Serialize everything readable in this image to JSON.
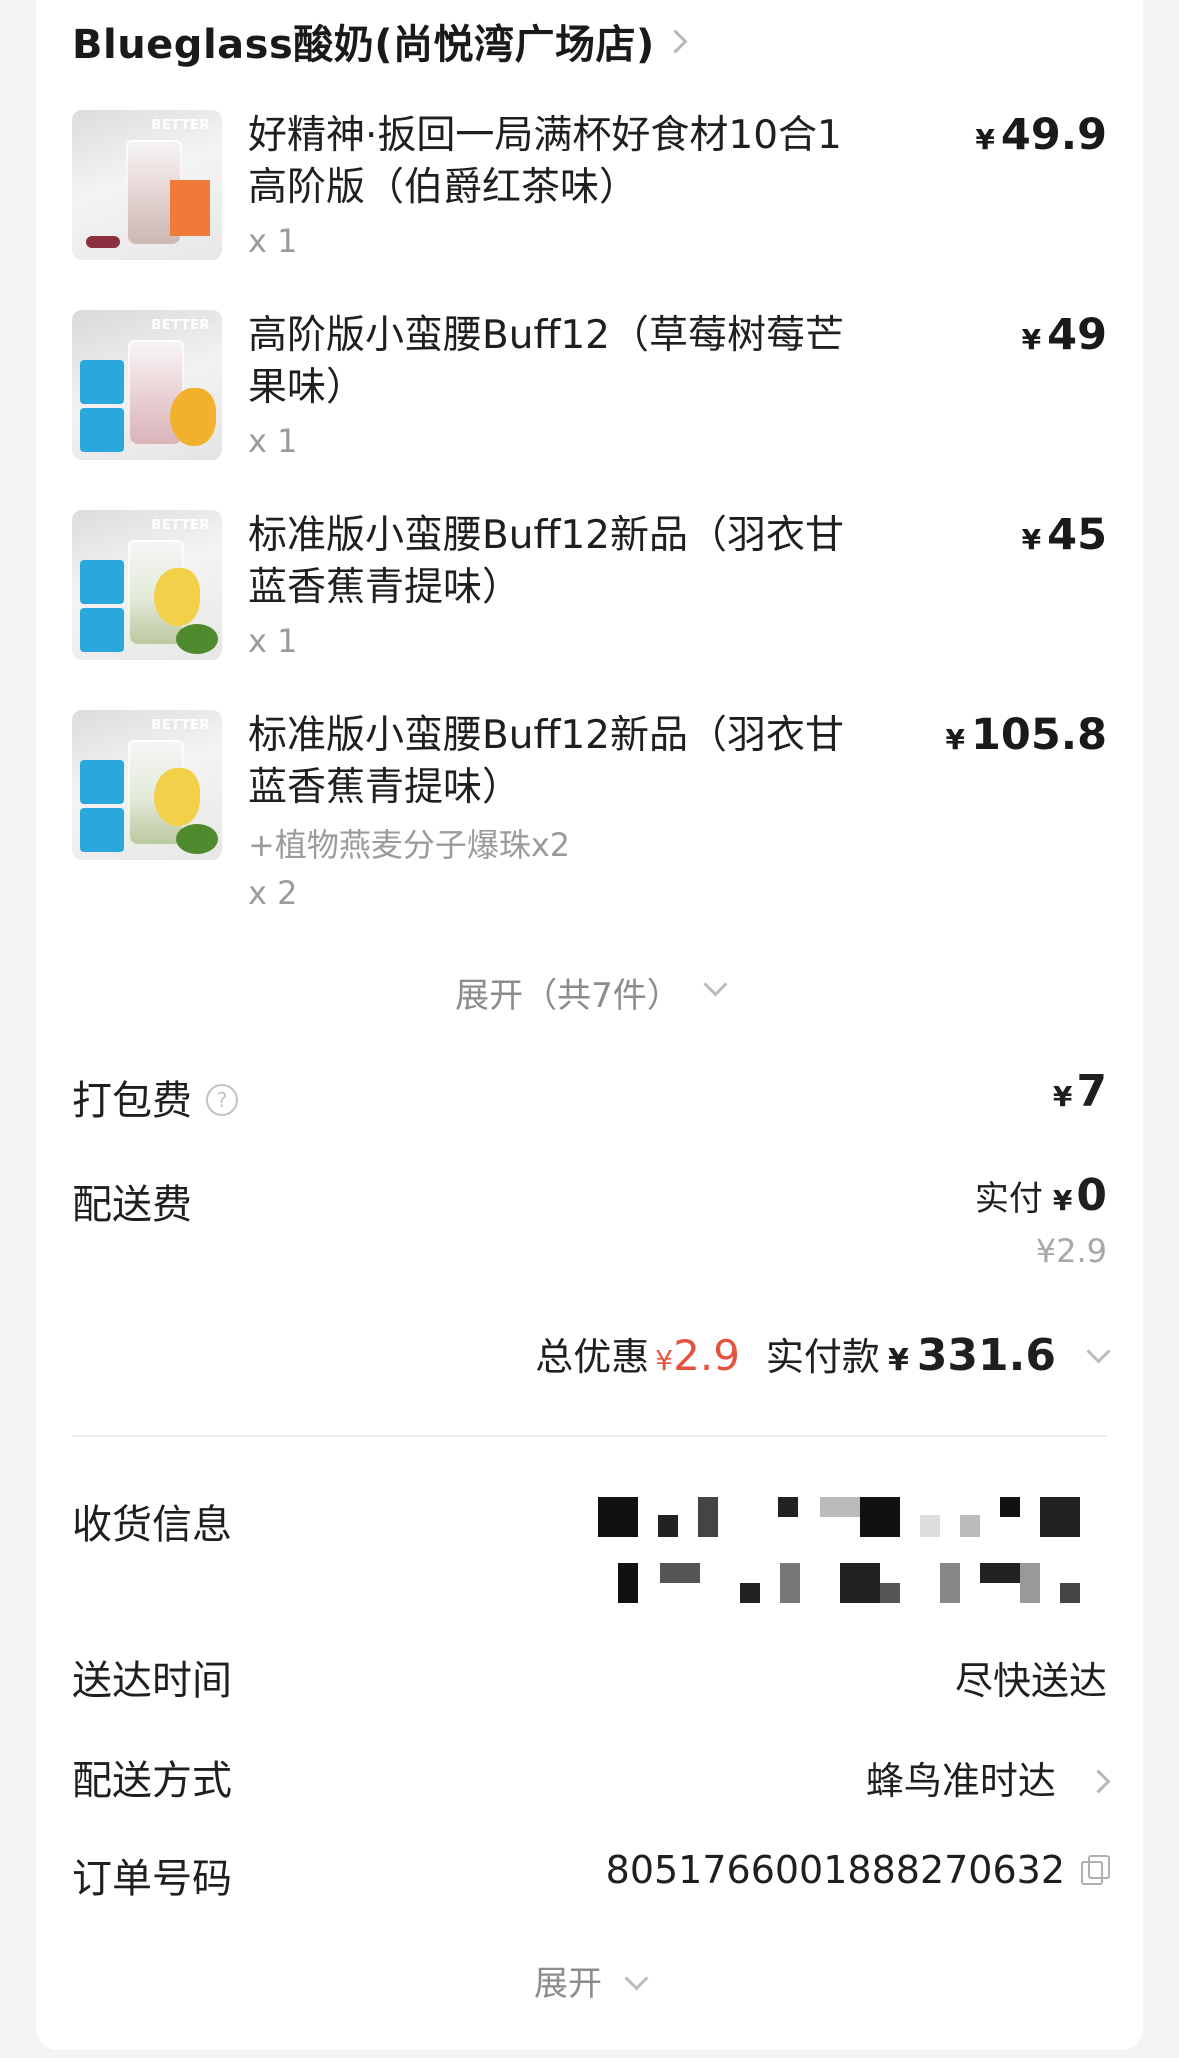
{
  "store": {
    "name": "Blueglass酸奶(尚悦湾广场店)"
  },
  "currency": "¥",
  "items": [
    {
      "name": "好精神·扳回一局满杯好食材10合1高阶版（伯爵红茶味）",
      "price": "49.9",
      "qty": "x 1",
      "addon": ""
    },
    {
      "name": "高阶版小蛮腰Buff12（草莓树莓芒果味）",
      "price": "49",
      "qty": "x 1",
      "addon": ""
    },
    {
      "name": "标准版小蛮腰Buff12新品（羽衣甘蓝香蕉青提味）",
      "price": "45",
      "qty": "x 1",
      "addon": ""
    },
    {
      "name": "标准版小蛮腰Buff12新品（羽衣甘蓝香蕉青提味）",
      "price": "105.8",
      "qty": "x 2",
      "addon": "+植物燕麦分子爆珠x2"
    }
  ],
  "thumb_brand": "BETTER",
  "expand_items": "展开（共7件）",
  "packing": {
    "label": "打包费",
    "help": "?",
    "amount": "7"
  },
  "delivery_fee": {
    "label": "配送费",
    "paid_prefix": "实付",
    "paid_amount": "0",
    "original": "¥2.9"
  },
  "summary": {
    "discount_label": "总优惠",
    "discount_amount": "2.9",
    "paid_label": "实付款",
    "paid_amount": "331.6"
  },
  "info": {
    "receiver": {
      "label": "收货信息"
    },
    "time": {
      "label": "送达时间",
      "value": "尽快送达"
    },
    "method": {
      "label": "配送方式",
      "value": "蜂鸟准时达"
    },
    "order": {
      "label": "订单号码",
      "value": "8051766001888270632"
    }
  },
  "bottom_expand": "展开",
  "colors": {
    "accent_red": "#e5533f",
    "muted": "#9b9b9b"
  }
}
